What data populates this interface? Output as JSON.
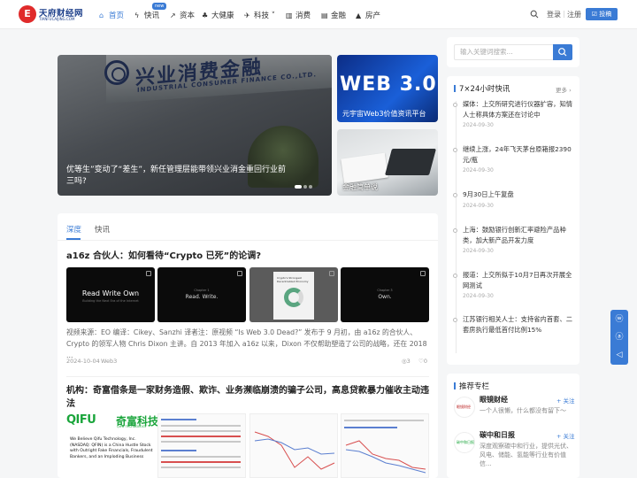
{
  "brand": {
    "logo_mark": "E",
    "name": "天府财经网",
    "sub": "TIANFUCAIJING.COM"
  },
  "nav": {
    "items": [
      {
        "icon": "⌂",
        "label": "首页"
      },
      {
        "icon": "ϟ",
        "label": "快讯"
      },
      {
        "icon": "↗",
        "label": "资本"
      },
      {
        "icon": "♣",
        "label": "大健康"
      },
      {
        "icon": "✈",
        "label": "科技 ˅"
      },
      {
        "icon": "▥",
        "label": "消费"
      },
      {
        "icon": "▤",
        "label": "金融"
      },
      {
        "icon": "▲",
        "label": "房产"
      }
    ],
    "new_badge": "new"
  },
  "header": {
    "login": "登录",
    "separator": "|",
    "register": "注册",
    "contribute": "☑ 投稿"
  },
  "carousel": {
    "sign_cn": "兴业消费金融",
    "sign_en": "INDUSTRIAL CONSUMER FINANCE CO.,LTD.",
    "title": "优等生”变动了“差生”，新任管理层能带领兴业消金重回行业前三吗?"
  },
  "side_cards": [
    {
      "art": "WEB 3.0",
      "caption": "元宇宙Web3价值资讯平台"
    },
    {
      "caption": "金融简单说"
    }
  ],
  "tabs": [
    "深度",
    "快讯"
  ],
  "articles": [
    {
      "title": "a16z 合伙人：如何看待“Crypto 已死”的论调?",
      "thumbs": [
        {
          "title": "Read Write Own",
          "sub": "Building the Next Era of the Internet"
        },
        {
          "title": "Read. Write.",
          "sub": "Chapter 1"
        },
        {
          "title": "Crypto's Strongest Decentralized Economy"
        },
        {
          "title": "Own.",
          "sub": "Chapter 3"
        }
      ],
      "excerpt": "视频来源：EO 编译：Cikey、Sanzhi 译者注：原视频 “Is Web 3.0 Dead?” 发布于 9 月初，由 a16z 的合伙人、Crypto 的领军人物 Chris Dixon 主讲。自 2013 年加入 a16z 以来，Dixon 不仅帮助塑造了公司的战略，还在 2018 ...",
      "date": "2024-10-04",
      "tag": "Web3",
      "comments": "◎3",
      "likes": "♡0"
    },
    {
      "title": "机构：奇富借条是一家财务造假、欺诈、业务濒临崩溃的骗子公司，高息贷款暴力催收主动违法",
      "thumb_logo": "QIFU",
      "thumb_cn": "奇富科技",
      "thumb_en": "QIFU TECHNOLOGY",
      "thumb_body": "We Believe Qifu Technology, Inc. (NASDAQ: QFIN) is a China Hustle Stock with Outright Fake Financials, Fraudulent Bankers, and an Imploding Business"
    }
  ],
  "sidebar": {
    "search_placeholder": "输入关键词搜索...",
    "flash_title": "7×24小时快讯",
    "more": "更多 ›",
    "news": [
      {
        "text": "媒体：上交所研究进行仪器扩容，知情人士称具体方案还在讨论中",
        "date": "2024-09-30"
      },
      {
        "text": "继续上涨，24年飞天茅台原箱报2390元/瓶",
        "date": "2024-09-30"
      },
      {
        "text": "9月30日上午复盘",
        "date": "2024-09-30"
      },
      {
        "text": "上海：鼓励银行创新汇率避险产品种类，加大新产品开发力度",
        "date": "2024-09-30"
      },
      {
        "text": "报道：上交所拟于10月7日再次开展全网测试",
        "date": "2024-09-30"
      },
      {
        "text": "江苏银行相关人士：支持省内首套、二套房执行最低首付比例15%",
        "date": "2024-09-30"
      }
    ],
    "columns_title": "推荐专栏",
    "columns": [
      {
        "avatar": "眼镜财经",
        "name": "眼镜财经",
        "follow": "+ 关注",
        "desc": "一个人很懒，什么都没有留下～"
      },
      {
        "avatar": "碳中和日报",
        "name": "碳中和日报",
        "follow": "+ 关注",
        "desc": "深度观察碳中和行业，提供光伏、风电、储能、氢能等行业有价值信..."
      }
    ]
  },
  "floating": [
    "ⓦ",
    "ⓐ",
    "◁"
  ],
  "colors": {
    "accent": "#3a7bd5",
    "logo": "#e02b2b",
    "qifu_green": "#1aa53b"
  }
}
